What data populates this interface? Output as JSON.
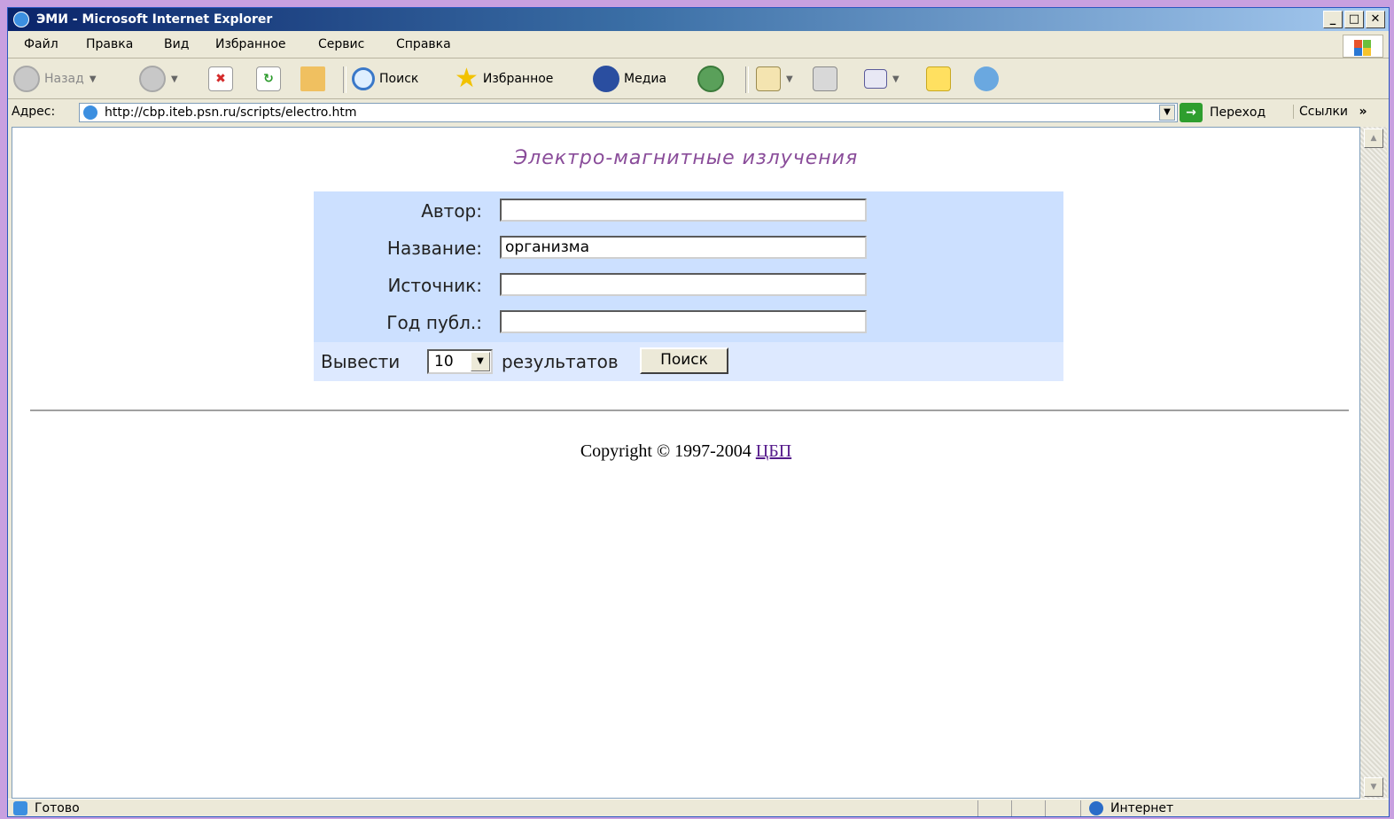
{
  "window": {
    "title": "ЭМИ - Microsoft Internet Explorer",
    "controls": {
      "minimize": "_",
      "maximize": "□",
      "close": "✕"
    }
  },
  "menu": {
    "items": [
      "Файл",
      "Правка",
      "Вид",
      "Избранное",
      "Сервис",
      "Справка"
    ]
  },
  "toolbar": {
    "back": "Назад",
    "search": "Поиск",
    "favorites": "Избранное",
    "media": "Медиа"
  },
  "address": {
    "label": "Адрес:",
    "url": "http://cbp.iteb.psn.ru/scripts/electro.htm",
    "go": "Переход",
    "links": "Ссылки",
    "more": "»"
  },
  "page": {
    "title": "Электро-магнитные излучения",
    "form": {
      "author_label": "Автор:",
      "author_value": "",
      "name_label": "Название:",
      "name_value": "организма",
      "source_label": "Источник:",
      "source_value": "",
      "year_label": "Год публ.:",
      "year_value": "",
      "show_label": "Вывести",
      "count_value": "10",
      "results_label": "результатов",
      "search_button": "Поиск"
    },
    "copyright_text": "Copyright © 1997-2004 ",
    "copyright_link": "ЦБП"
  },
  "status": {
    "text": "Готово",
    "zone": "Интернет"
  },
  "colors": {
    "title_color": "#8a4d9a",
    "form_top_bg": "#cce0ff",
    "form_bottom_bg": "#dde9ff",
    "link_visited": "#551a8b"
  }
}
